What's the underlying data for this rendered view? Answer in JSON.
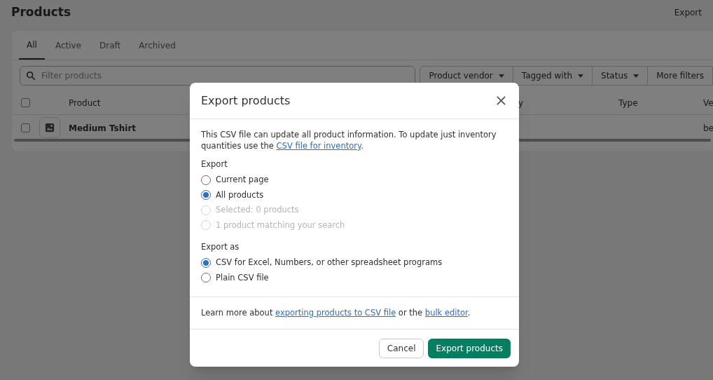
{
  "page": {
    "title": "Products",
    "action": "Export"
  },
  "tabs": [
    {
      "label": "All",
      "selected": true
    },
    {
      "label": "Active",
      "selected": false
    },
    {
      "label": "Draft",
      "selected": false
    },
    {
      "label": "Archived",
      "selected": false
    }
  ],
  "search": {
    "placeholder": "Filter products"
  },
  "filters": [
    "Product vendor",
    "Tagged with",
    "Status",
    "More filters"
  ],
  "table": {
    "select_all_checked": false,
    "columns": [
      {
        "label": "Product"
      },
      {
        "label": "y"
      },
      {
        "label": "Type"
      },
      {
        "label": "Ve"
      }
    ],
    "rows": [
      {
        "checked": false,
        "product": "Medium Tshirt",
        "column_4": "be"
      }
    ]
  },
  "modal": {
    "title": "Export products",
    "intro": "This CSV file can update all product information. To update just inventory quantities use the ",
    "intro_link": "CSV file for inventory",
    "intro_end": ".",
    "groups": [
      {
        "label": "Export",
        "options": [
          {
            "label": "Current page",
            "selected": false,
            "disabled": false
          },
          {
            "label": "All products",
            "selected": true,
            "disabled": false
          },
          {
            "label": "Selected: 0 products",
            "selected": false,
            "disabled": true
          },
          {
            "label": "1 product matching your search",
            "selected": false,
            "disabled": true
          }
        ]
      },
      {
        "label": "Export as",
        "options": [
          {
            "label": "CSV for Excel, Numbers, or other spreadsheet programs",
            "selected": true,
            "disabled": false
          },
          {
            "label": "Plain CSV file",
            "selected": false,
            "disabled": false
          }
        ]
      }
    ],
    "footer_text": [
      {
        "kind": "text",
        "text": "Learn more about "
      },
      {
        "kind": "link",
        "text": "exporting products to CSV file"
      },
      {
        "kind": "text",
        "text": " or the "
      },
      {
        "kind": "link",
        "text": "bulk editor"
      },
      {
        "kind": "text",
        "text": "."
      }
    ],
    "buttons": [
      {
        "label": "Cancel",
        "kind": "secondary"
      },
      {
        "label": "Export products",
        "kind": "primary"
      }
    ]
  }
}
